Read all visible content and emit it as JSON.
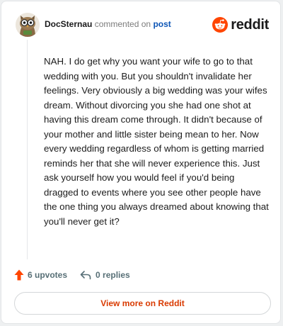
{
  "comment": {
    "username": "DocSternau",
    "action_text": "commented on",
    "post_link_text": "post",
    "body": "NAH. I do get why you want your wife to go to that wedding with you. But you shouldn't invalidate her feelings. Very obviously a big wedding was your wifes dream. Without divorcing you she had one shot at having this dream come through. It didn't because of your mother and little sister being mean to her. Now every wedding regardless of whom is getting married reminds her that she will never experience this. Just ask yourself how you would feel if you'd being dragged to events where you see other people have the one thing you always dreamed about knowing that you'll never get it?"
  },
  "brand": {
    "name": "reddit",
    "icon": "reddit-snoo-icon",
    "color": "#ff4500"
  },
  "stats": {
    "upvotes_label": "6 upvotes",
    "replies_label": "0 replies",
    "upvote_icon": "upvote-arrow-icon",
    "reply_icon": "reply-arrow-icon",
    "upvote_color": "#ff4500"
  },
  "cta": {
    "label": "View more on Reddit",
    "color": "#d93a00"
  }
}
